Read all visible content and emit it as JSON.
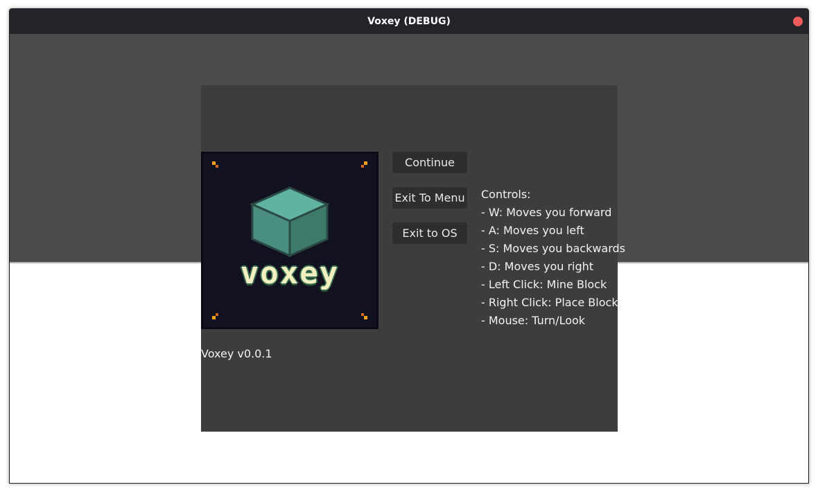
{
  "window": {
    "title": "Voxey (DEBUG)"
  },
  "pause_menu": {
    "logo": {
      "word": "voxey",
      "alt": "Voxey logo"
    },
    "buttons": {
      "continue": "Continue",
      "exit_to_menu": "Exit To Menu",
      "exit_to_os": "Exit to OS"
    },
    "controls": {
      "heading": "Controls:",
      "items": [
        "- W: Moves you forward",
        "- A: Moves you left",
        "- S: Moves you backwards",
        "- D: Moves you right",
        "- Left Click: Mine Block",
        "- Right Click: Place Block",
        "- Mouse: Turn/Look"
      ]
    },
    "version": "Voxey v0.0.1"
  },
  "colors": {
    "titlebar": "#232329",
    "close_button": "#ee5b5b",
    "sky": "#4b4b4b",
    "panel": "#3d3d3d",
    "button": "#2e2e2e",
    "logo_background": "#12111f",
    "cube_top": "#5fb3a0",
    "cube_side": "#3e7a6c"
  }
}
